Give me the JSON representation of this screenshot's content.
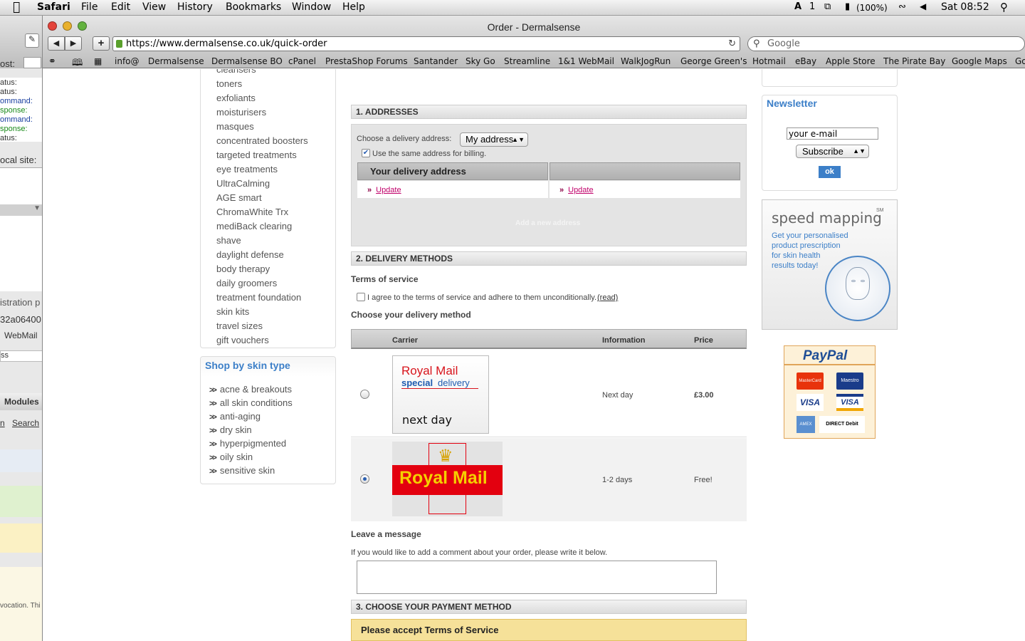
{
  "menubar": {
    "app": "Safari",
    "items": [
      "File",
      "Edit",
      "View",
      "History",
      "Bookmarks",
      "Window",
      "Help"
    ],
    "status": {
      "adobe": "1",
      "battery": "(100%)",
      "clock": "Sat 08:52"
    }
  },
  "backwindow": {
    "lines": [
      "ost:",
      "atus:",
      "atus:",
      "ommand:",
      "sponse:",
      "ommand:",
      "sponse:",
      "atus:",
      "ocal site:",
      "istration p",
      "32a06400",
      "WebMail",
      "ss",
      "Modules",
      "n",
      "Search",
      "vocation. Thi"
    ]
  },
  "window": {
    "title": "Order - Dermalsense",
    "url": "https://www.dermalsense.co.uk/quick-order",
    "search_placeholder": "Google",
    "bookmarks": [
      "info@",
      "Dermalsense",
      "Dermalsense BO",
      "cPanel",
      "PrestaShop Forums",
      "Santander",
      "Sky Go",
      "Streamline",
      "1&1 WebMail",
      "WalkJogRun",
      "George Green's",
      "Hotmail",
      "eBay",
      "Apple Store",
      "The Pirate Bay",
      "Google Maps",
      "Go"
    ]
  },
  "sidebar": {
    "categories": [
      "cleansers",
      "toners",
      "exfoliants",
      "moisturisers",
      "masques",
      "concentrated boosters",
      "targeted treatments",
      "eye treatments",
      "UltraCalming",
      "AGE smart",
      "ChromaWhite Trx",
      "mediBack clearing",
      "shave",
      "daylight defense",
      "body therapy",
      "daily groomers",
      "treatment foundation",
      "skin kits",
      "travel sizes",
      "gift vouchers"
    ],
    "skin_title": "Shop by skin type",
    "skin_types": [
      "acne & breakouts",
      "all skin conditions",
      "anti-aging",
      "dry skin",
      "hyperpigmented",
      "oily skin",
      "sensitive skin"
    ]
  },
  "addresses": {
    "heading": "1. ADDRESSES",
    "choose_label": "Choose a delivery address:",
    "selected_address": "My address",
    "same_billing": "Use the same address for billing.",
    "delivery_col": "Your delivery address",
    "update": "Update",
    "add_new": "Add a new address"
  },
  "delivery": {
    "heading": "2. DELIVERY METHODS",
    "terms_title": "Terms of service",
    "terms_text": "I agree to the terms of service and adhere to them unconditionally.",
    "terms_link": "(read)",
    "choose_title": "Choose your delivery method",
    "columns": {
      "carrier": "Carrier",
      "information": "Information",
      "price": "Price"
    },
    "options": [
      {
        "logo_line1": "Royal Mail",
        "logo_line2a": "special",
        "logo_line2b": "delivery",
        "logo_line3": "next day",
        "information": "Next day",
        "price": "£3.00",
        "selected": false
      },
      {
        "logo_text": "Royal Mail",
        "information": "1-2 days",
        "price": "Free!",
        "selected": true
      }
    ]
  },
  "message": {
    "title": "Leave a message",
    "hint": "If you would like to add a comment about your order, please write it below.",
    "value": ""
  },
  "payment": {
    "heading": "3. CHOOSE YOUR PAYMENT METHOD",
    "warning": "Please accept Terms of Service"
  },
  "newsletter": {
    "title": "Newsletter",
    "email_value": "your e-mail",
    "select_value": "Subscribe",
    "ok": "ok"
  },
  "speedmap": {
    "title": "speed mapping",
    "sup": "SM",
    "text": [
      "Get your personalised",
      "product prescription",
      "for skin health",
      "results today!"
    ]
  },
  "paypal": {
    "title": "PayPal",
    "cards": [
      "MasterCard",
      "Maestro",
      "VISA",
      "VISA",
      "AMEX",
      "DIRECT Debit"
    ]
  },
  "colors": {
    "accent_blue": "#3c7fc8",
    "warning_bg": "#f6e199",
    "update_pink": "#c0006a",
    "royalmail_red": "#e3000f",
    "royalmail_yellow": "#f5d000"
  }
}
